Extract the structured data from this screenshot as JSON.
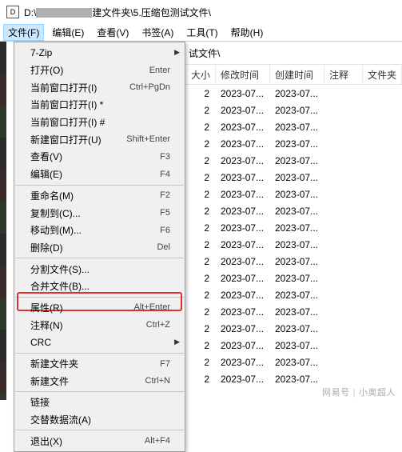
{
  "titlebar": {
    "icon_text": "D",
    "path_prefix": "D:\\",
    "path_suffix": "建文件夹\\5.压缩包测试文件\\"
  },
  "menubar": {
    "items": [
      {
        "label": "文件(F)",
        "active": true
      },
      {
        "label": "编辑(E)"
      },
      {
        "label": "查看(V)"
      },
      {
        "label": "书签(A)"
      },
      {
        "label": "工具(T)"
      },
      {
        "label": "帮助(H)"
      }
    ]
  },
  "dropdown": [
    {
      "type": "item",
      "label": "7-Zip",
      "shortcut": "",
      "submenu": true
    },
    {
      "type": "item",
      "label": "打开(O)",
      "shortcut": "Enter"
    },
    {
      "type": "item",
      "label": "当前窗口打开(I)",
      "shortcut": "Ctrl+PgDn"
    },
    {
      "type": "item",
      "label": "当前窗口打开(I) *",
      "shortcut": ""
    },
    {
      "type": "item",
      "label": "当前窗口打开(I) #",
      "shortcut": ""
    },
    {
      "type": "item",
      "label": "新建窗口打开(U)",
      "shortcut": "Shift+Enter"
    },
    {
      "type": "item",
      "label": "查看(V)",
      "shortcut": "F3"
    },
    {
      "type": "item",
      "label": "编辑(E)",
      "shortcut": "F4"
    },
    {
      "type": "sep"
    },
    {
      "type": "item",
      "label": "重命名(M)",
      "shortcut": "F2"
    },
    {
      "type": "item",
      "label": "复制到(C)...",
      "shortcut": "F5"
    },
    {
      "type": "item",
      "label": "移动到(M)...",
      "shortcut": "F6"
    },
    {
      "type": "item",
      "label": "删除(D)",
      "shortcut": "Del"
    },
    {
      "type": "sep"
    },
    {
      "type": "item",
      "label": "分割文件(S)...",
      "shortcut": ""
    },
    {
      "type": "item",
      "label": "合并文件(B)...",
      "shortcut": "",
      "highlighted": true
    },
    {
      "type": "sep"
    },
    {
      "type": "item",
      "label": "属性(R)",
      "shortcut": "Alt+Enter"
    },
    {
      "type": "item",
      "label": "注释(N)",
      "shortcut": "Ctrl+Z"
    },
    {
      "type": "item",
      "label": "CRC",
      "shortcut": "",
      "submenu": true
    },
    {
      "type": "sep"
    },
    {
      "type": "item",
      "label": "新建文件夹",
      "shortcut": "F7"
    },
    {
      "type": "item",
      "label": "新建文件",
      "shortcut": "Ctrl+N"
    },
    {
      "type": "sep"
    },
    {
      "type": "item",
      "label": "链接",
      "shortcut": ""
    },
    {
      "type": "item",
      "label": "交替数据流(A)",
      "shortcut": ""
    },
    {
      "type": "sep"
    },
    {
      "type": "item",
      "label": "退出(X)",
      "shortcut": "Alt+F4"
    }
  ],
  "content": {
    "path_suffix": "试文件\\",
    "columns": {
      "size": "大小",
      "mtime": "修改时间",
      "ctime": "创建时间",
      "note": "注释",
      "folder": "文件夹"
    },
    "rows": [
      {
        "size": "2",
        "mtime": "2023-07...",
        "ctime": "2023-07..."
      },
      {
        "size": "2",
        "mtime": "2023-07...",
        "ctime": "2023-07..."
      },
      {
        "size": "2",
        "mtime": "2023-07...",
        "ctime": "2023-07..."
      },
      {
        "size": "2",
        "mtime": "2023-07...",
        "ctime": "2023-07..."
      },
      {
        "size": "2",
        "mtime": "2023-07...",
        "ctime": "2023-07..."
      },
      {
        "size": "2",
        "mtime": "2023-07...",
        "ctime": "2023-07..."
      },
      {
        "size": "2",
        "mtime": "2023-07...",
        "ctime": "2023-07..."
      },
      {
        "size": "2",
        "mtime": "2023-07...",
        "ctime": "2023-07..."
      },
      {
        "size": "2",
        "mtime": "2023-07...",
        "ctime": "2023-07..."
      },
      {
        "size": "2",
        "mtime": "2023-07...",
        "ctime": "2023-07..."
      },
      {
        "size": "2",
        "mtime": "2023-07...",
        "ctime": "2023-07..."
      },
      {
        "size": "2",
        "mtime": "2023-07...",
        "ctime": "2023-07..."
      },
      {
        "size": "2",
        "mtime": "2023-07...",
        "ctime": "2023-07..."
      },
      {
        "size": "2",
        "mtime": "2023-07...",
        "ctime": "2023-07..."
      },
      {
        "size": "2",
        "mtime": "2023-07...",
        "ctime": "2023-07..."
      },
      {
        "size": "2",
        "mtime": "2023-07...",
        "ctime": "2023-07..."
      },
      {
        "size": "2",
        "mtime": "2023-07...",
        "ctime": "2023-07..."
      },
      {
        "size": "2",
        "mtime": "2023-07...",
        "ctime": "2023-07..."
      }
    ]
  },
  "watermark": {
    "left": "网易号",
    "right": "小奥超人"
  }
}
